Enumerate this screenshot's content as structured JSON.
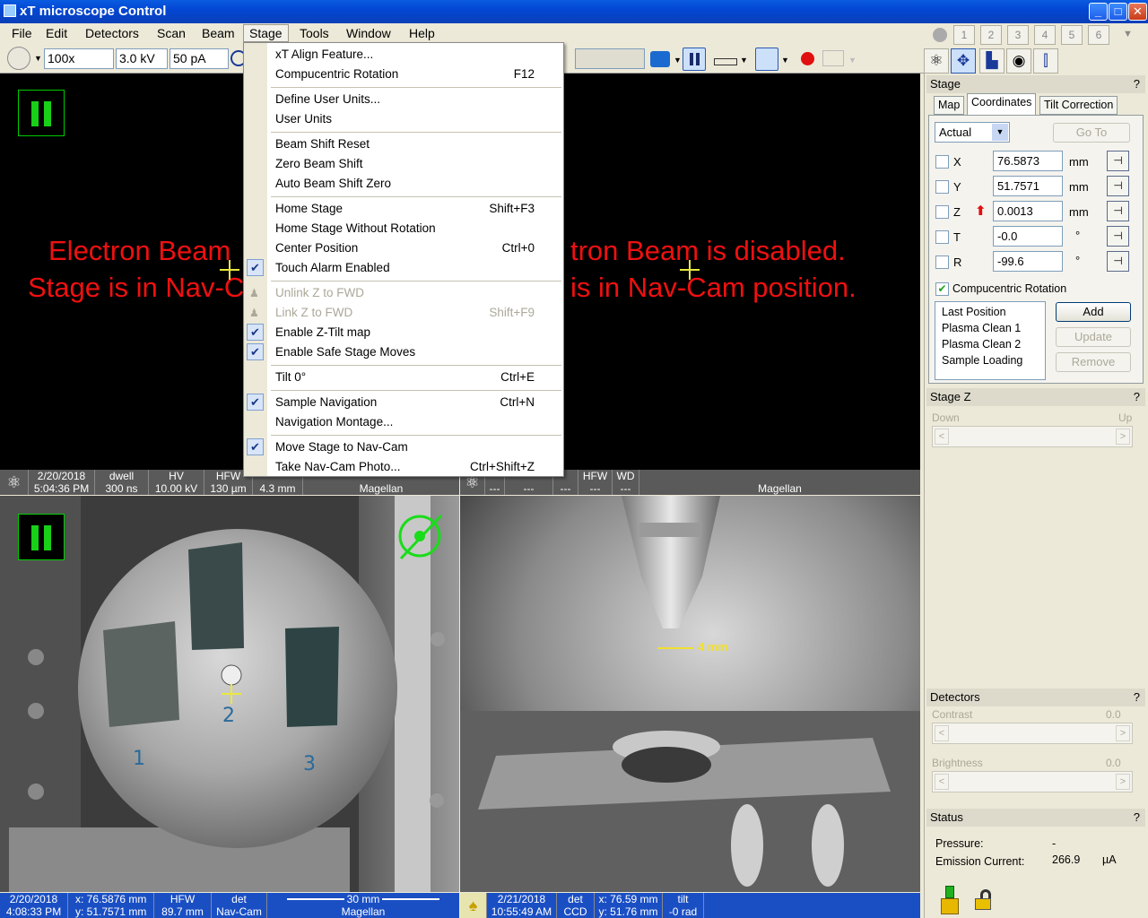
{
  "window": {
    "title": "xT microscope Control"
  },
  "menubar": [
    "File",
    "Edit",
    "Detectors",
    "Scan",
    "Beam",
    "Stage",
    "Tools",
    "Window",
    "Help"
  ],
  "toolbar": {
    "magnification": "100x",
    "hv": "3.0 kV",
    "current": "50 pA"
  },
  "right_toolbar": {
    "preset_buttons": [
      "1",
      "2",
      "3",
      "4",
      "5",
      "6"
    ]
  },
  "quad1": {
    "overlay_line1_left": "Electron Beam",
    "overlay_line2_left": "Stage is in Nav-C",
    "overlay_line1_right": "tron Beam is disabled.",
    "overlay_line2_right": "is in Nav-Cam position."
  },
  "status_top_left": {
    "date": "2/20/2018",
    "time": "5:04:36 PM",
    "dwell_h": "dwell",
    "dwell": "300 ns",
    "hv_h": "HV",
    "hv": "10.00 kV",
    "hfw_h": "HFW",
    "hfw": "130 µm",
    "wd": "4.3 mm",
    "name": "Magellan"
  },
  "status_top_right": {
    "c1": "---",
    "c2": "---",
    "c3": "---",
    "hfw_h": "HFW",
    "hfw": "---",
    "wd_h": "WD",
    "wd": "---",
    "name": "Magellan"
  },
  "stage_menu": {
    "items": [
      {
        "label": "xT Align Feature...",
        "shortcut": ""
      },
      {
        "label": "Compucentric Rotation",
        "shortcut": "F12"
      },
      {
        "label": "Define User Units...",
        "shortcut": ""
      },
      {
        "label": "User Units",
        "shortcut": ""
      },
      {
        "label": "Beam Shift Reset",
        "shortcut": ""
      },
      {
        "label": "Zero Beam Shift",
        "shortcut": ""
      },
      {
        "label": "Auto Beam Shift Zero",
        "shortcut": ""
      },
      {
        "label": "Home Stage",
        "shortcut": "Shift+F3"
      },
      {
        "label": "Home Stage Without Rotation",
        "shortcut": ""
      },
      {
        "label": "Center Position",
        "shortcut": "Ctrl+0"
      },
      {
        "label": "Touch Alarm Enabled",
        "shortcut": ""
      },
      {
        "label": "Unlink Z to FWD",
        "shortcut": ""
      },
      {
        "label": "Link Z to FWD",
        "shortcut": "Shift+F9"
      },
      {
        "label": "Enable Z-Tilt map",
        "shortcut": ""
      },
      {
        "label": "Enable Safe Stage Moves",
        "shortcut": ""
      },
      {
        "label": "Tilt 0°",
        "shortcut": "Ctrl+E"
      },
      {
        "label": "Sample Navigation",
        "shortcut": "Ctrl+N"
      },
      {
        "label": "Navigation Montage...",
        "shortcut": ""
      },
      {
        "label": "Move Stage to Nav-Cam",
        "shortcut": ""
      },
      {
        "label": "Take Nav-Cam Photo...",
        "shortcut": "Ctrl+Shift+Z"
      }
    ]
  },
  "pane4": {
    "scale_label": "4 mm"
  },
  "status_bottom_left": {
    "date": "2/20/2018",
    "time": "4:08:33 PM",
    "x": "x: 76.5876 mm",
    "y": "y: 51.7571 mm",
    "hfw_h": "HFW",
    "hfw": "89.7 mm",
    "det_h": "det",
    "det": "Nav-Cam",
    "scale": "30 mm",
    "name": "Magellan"
  },
  "status_bottom_right": {
    "date": "2/21/2018",
    "time": "10:55:49 AM",
    "det_h": "det",
    "det": "CCD",
    "x": "x: 76.59 mm",
    "y": "y: 51.76 mm",
    "tilt_h": "tilt",
    "tilt": "-0 rad"
  },
  "stage_panel": {
    "title": "Stage",
    "help": "?",
    "tabs": [
      "Map",
      "Coordinates",
      "Tilt Correction"
    ],
    "mode": "Actual",
    "goto": "Go To",
    "coords": [
      {
        "axis": "X",
        "value": "76.5873",
        "unit": "mm"
      },
      {
        "axis": "Y",
        "value": "51.7571",
        "unit": "mm"
      },
      {
        "axis": "Z",
        "value": "0.0013",
        "unit": "mm"
      },
      {
        "axis": "T",
        "value": "-0.0",
        "unit": "°"
      },
      {
        "axis": "R",
        "value": "-99.6",
        "unit": "°"
      }
    ],
    "compucentric": "Compucentric Rotation",
    "positions": [
      "Last Position",
      "Plasma Clean 1",
      "Plasma Clean 2",
      "Sample Loading"
    ],
    "add": "Add",
    "update": "Update",
    "remove": "Remove"
  },
  "stage_z": {
    "title": "Stage Z",
    "help": "?",
    "down": "Down",
    "up": "Up"
  },
  "detectors": {
    "title": "Detectors",
    "help": "?",
    "contrast": "Contrast",
    "contrast_val": "0.0",
    "brightness": "Brightness",
    "brightness_val": "0.0"
  },
  "status_panel": {
    "title": "Status",
    "help": "?",
    "pressure_label": "Pressure:",
    "pressure_val": "-",
    "emission_label": "Emission Current:",
    "emission_val": "266.9",
    "emission_unit": "µA"
  }
}
